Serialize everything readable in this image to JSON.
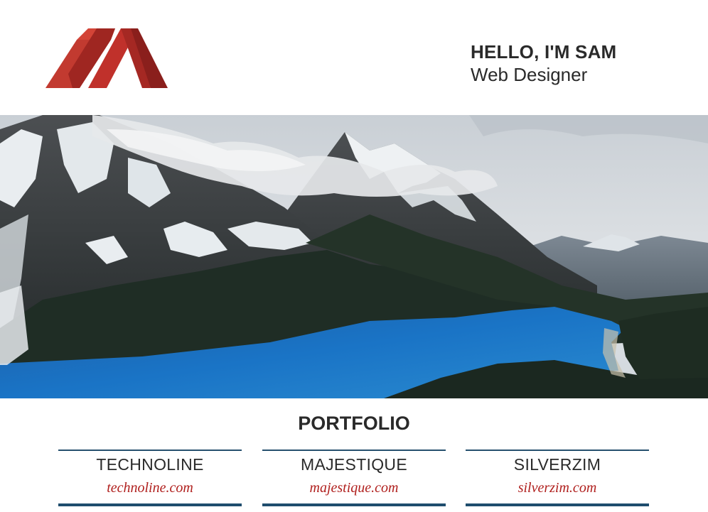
{
  "header": {
    "greeting": "HELLO, I'M SAM",
    "role": "Web Designer",
    "logo_icon": "mountain-logo-icon",
    "logo_colors": {
      "light": "#c0312b",
      "dark": "#8a1f1c"
    }
  },
  "hero": {
    "image": "mountain-lake-landscape",
    "colors": {
      "sky": "#d9dde1",
      "lake": "#1a6fbf",
      "forest": "#1d2a22"
    }
  },
  "portfolio": {
    "title": "PORTFOLIO",
    "projects": [
      {
        "name": "TECHNOLINE",
        "url": "technoline.com"
      },
      {
        "name": "MAJESTIQUE",
        "url": "majestique.com"
      },
      {
        "name": "SILVERZIM",
        "url": "silverzim.com"
      }
    ],
    "accent_color": "#1f4d6e",
    "link_color": "#b0201e"
  }
}
